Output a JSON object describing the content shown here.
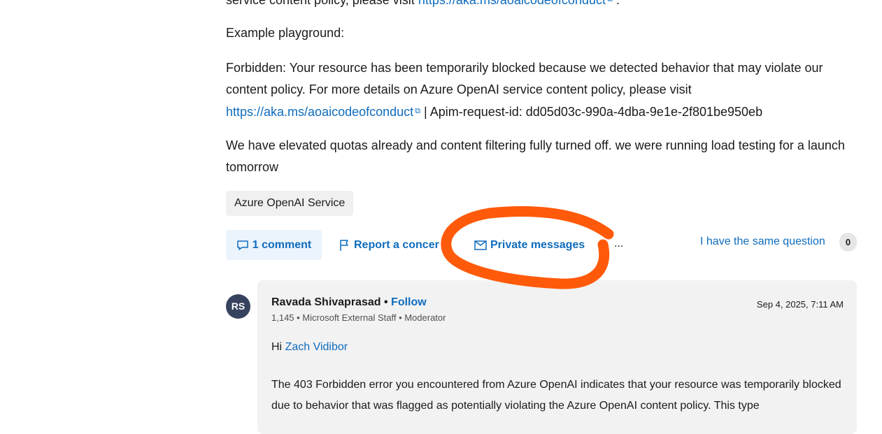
{
  "question": {
    "clipped_top_text": "service content policy, please visit",
    "clipped_top_link": "https://aka.ms/aoaicodeofconduct",
    "example_label": "Example playground:",
    "error_text": "Forbidden: Your resource has been temporarily blocked because we detected behavior that may violate our content policy. For more details on Azure OpenAI service content policy, please visit",
    "error_link": "https://aka.ms/aoaicodeofconduct",
    "request_id_text": "| Apim-request-id: dd05d03c-990a-4dba-9e1e-2f801be950eb",
    "note_text": "We have elevated quotas already and content filtering fully turned off. we were running load testing for a launch tomorrow",
    "tag": "Azure OpenAI Service"
  },
  "actions": {
    "comment_label": "1 comment",
    "report_label": "Report a concern",
    "private_messages_label": "Private messages",
    "more_label": "...",
    "same_question_label": "I have the same question",
    "same_question_count": "0"
  },
  "answer": {
    "avatar_initials": "RS",
    "author_name": "Ravada Shivaprasad",
    "bullet": "•",
    "follow_label": "Follow",
    "meta": "1,145 • Microsoft External Staff • Moderator",
    "date": "Sep 4, 2025, 7:11 AM",
    "greeting_prefix": "Hi",
    "greeting_name": "Zach Vidibor",
    "body": "The 403 Forbidden error you encountered from Azure OpenAI indicates that your resource was temporarily blocked due to behavior that was flagged as potentially violating the Azure OpenAI content policy. This type"
  },
  "colors": {
    "link": "#0f6cbd",
    "annotation": "#ff5a0a",
    "avatar_bg": "#37425e"
  }
}
